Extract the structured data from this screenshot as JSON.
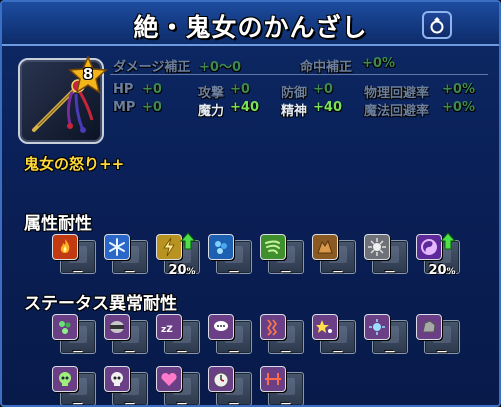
{
  "title": "絶・鬼女のかんざし",
  "accessory_icon": "ring-icon",
  "item": {
    "level": "8",
    "skill": "鬼女の怒り++"
  },
  "stats": {
    "damage_label": "ダメージ補正",
    "damage_value": "+0～0",
    "hit_label": "命中補正",
    "hit_value": "+0%",
    "hp_label": "HP",
    "hp_value": "+0",
    "mp_label": "MP",
    "mp_value": "+0",
    "atk_label": "攻撃",
    "atk_value": "+0",
    "mag_label": "魔力",
    "mag_value": "+40",
    "def_label": "防御",
    "def_value": "+0",
    "spr_label": "精神",
    "spr_value": "+40",
    "peva_label": "物理回避率",
    "peva_value": "+0%",
    "meva_label": "魔法回避率",
    "meva_value": "+0%"
  },
  "elemental": {
    "title": "属性耐性",
    "items": [
      {
        "name": "fire",
        "icon": "fire-icon",
        "value": "－",
        "up": false,
        "bg": "#c23a12"
      },
      {
        "name": "ice",
        "icon": "ice-icon",
        "value": "－",
        "up": false,
        "bg": "#2a67c8"
      },
      {
        "name": "lightning",
        "icon": "lightning-icon",
        "value": "20",
        "up": true,
        "bg": "#b89322"
      },
      {
        "name": "water",
        "icon": "water-icon",
        "value": "－",
        "up": false,
        "bg": "#1d5fb0"
      },
      {
        "name": "wind",
        "icon": "wind-icon",
        "value": "－",
        "up": false,
        "bg": "#3f8f2c"
      },
      {
        "name": "earth",
        "icon": "earth-icon",
        "value": "－",
        "up": false,
        "bg": "#8a5a22"
      },
      {
        "name": "light",
        "icon": "light-icon",
        "value": "－",
        "up": false,
        "bg": "#6e7278"
      },
      {
        "name": "dark",
        "icon": "dark-icon",
        "value": "20",
        "up": true,
        "bg": "#5d2a9a"
      }
    ],
    "pct": "%"
  },
  "ailment": {
    "title": "ステータス異常耐性",
    "items": [
      {
        "name": "poison",
        "icon": "poison-icon",
        "value": "－",
        "bg": "#6b3f86"
      },
      {
        "name": "blind",
        "icon": "blind-icon",
        "value": "－",
        "bg": "#6b3f86"
      },
      {
        "name": "sleep",
        "icon": "sleep-icon",
        "value": "－",
        "bg": "#6b3f86"
      },
      {
        "name": "silence",
        "icon": "silence-icon",
        "value": "－",
        "bg": "#6b3f86"
      },
      {
        "name": "paralyze",
        "icon": "paralyze-icon",
        "value": "－",
        "bg": "#6b3f86"
      },
      {
        "name": "confuse",
        "icon": "confuse-icon",
        "value": "－",
        "bg": "#6b3f86"
      },
      {
        "name": "disease",
        "icon": "disease-icon",
        "value": "－",
        "bg": "#6b3f86"
      },
      {
        "name": "petrify",
        "icon": "petrify-icon",
        "value": "－",
        "bg": "#6b3f86"
      },
      {
        "name": "death",
        "icon": "death-icon",
        "value": "－",
        "bg": "#6b3f86"
      },
      {
        "name": "doom",
        "icon": "doom-icon",
        "value": "－",
        "bg": "#6b3f86"
      },
      {
        "name": "charm",
        "icon": "charm-icon",
        "value": "－",
        "bg": "#6b3f86"
      },
      {
        "name": "stop",
        "icon": "stop-icon",
        "value": "－",
        "bg": "#6b3f86"
      },
      {
        "name": "berserk",
        "icon": "berserk-icon",
        "value": "－",
        "bg": "#6b3f86"
      }
    ]
  },
  "colors": {
    "panel": "#0a2058",
    "accent": "#3b6fc4",
    "skill": "#ffd93a",
    "bonus": "#7ae35a"
  }
}
